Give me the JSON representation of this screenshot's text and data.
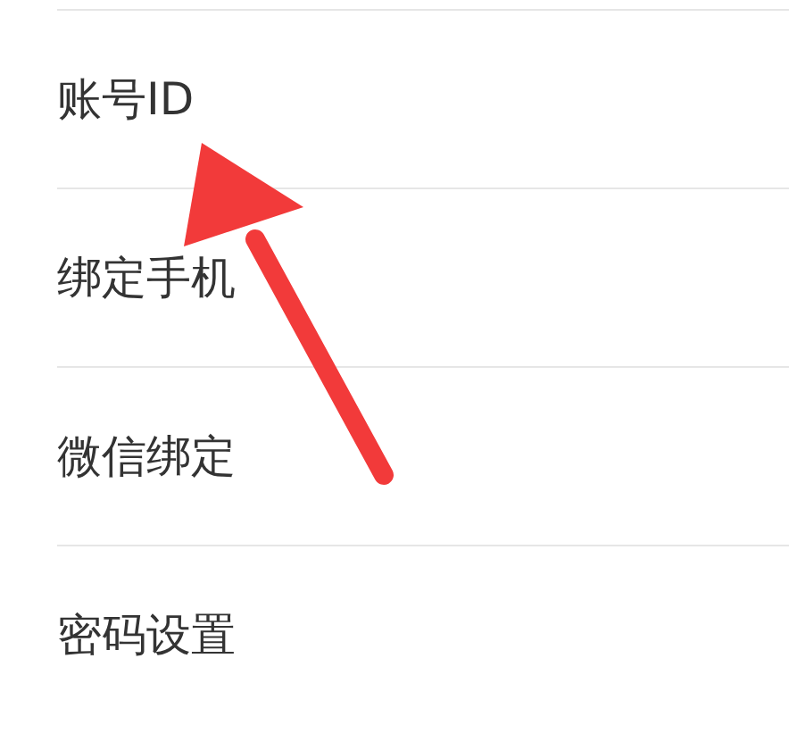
{
  "settings": [
    {
      "label": "账号ID"
    },
    {
      "label": "绑定手机"
    },
    {
      "label": "微信绑定"
    },
    {
      "label": "密码设置"
    }
  ]
}
